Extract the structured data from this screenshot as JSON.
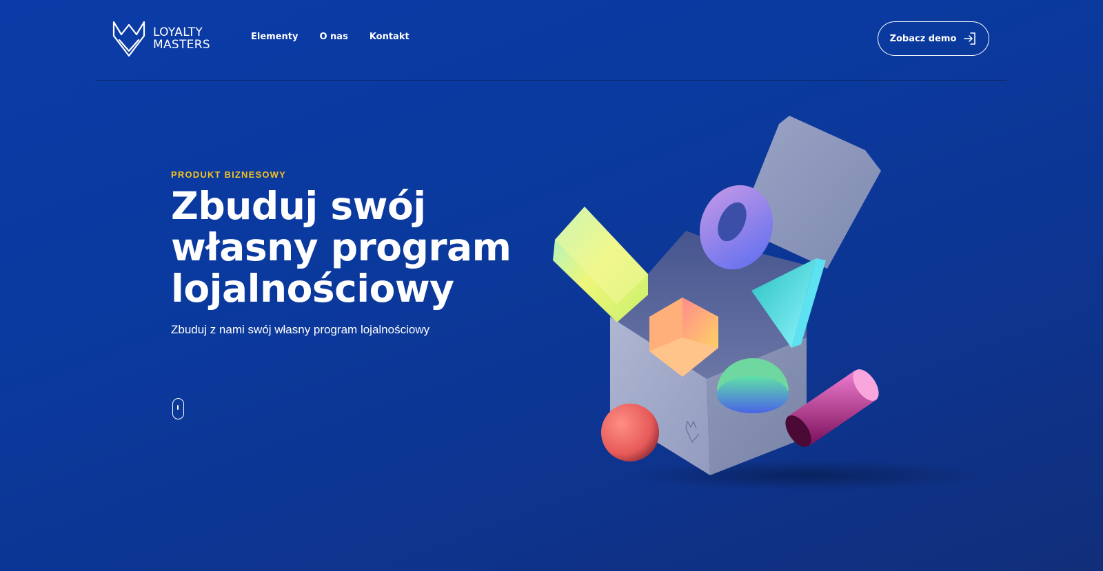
{
  "brand": {
    "line1": "LOYALTY",
    "line2": "MASTERS"
  },
  "nav": {
    "items": [
      {
        "label": "Elementy"
      },
      {
        "label": "O nas"
      },
      {
        "label": "Kontakt"
      }
    ]
  },
  "header": {
    "demo_label": "Zobacz demo"
  },
  "hero": {
    "eyebrow": "PRODUKT BIZNESOWY",
    "title_line1": "Zbuduj swój",
    "title_line2": "własny program",
    "title_line3": "lojalnościowy",
    "subtitle": "Zbuduj z nami swój własny program lojalnościowy"
  },
  "colors": {
    "background": "#0b3ba6",
    "accent": "#f4c21e",
    "text": "#ffffff"
  },
  "icons": {
    "logo": "loyalty-masters-logo-icon",
    "demo": "arrow-into-box-icon",
    "scroll": "mouse-scroll-icon"
  }
}
